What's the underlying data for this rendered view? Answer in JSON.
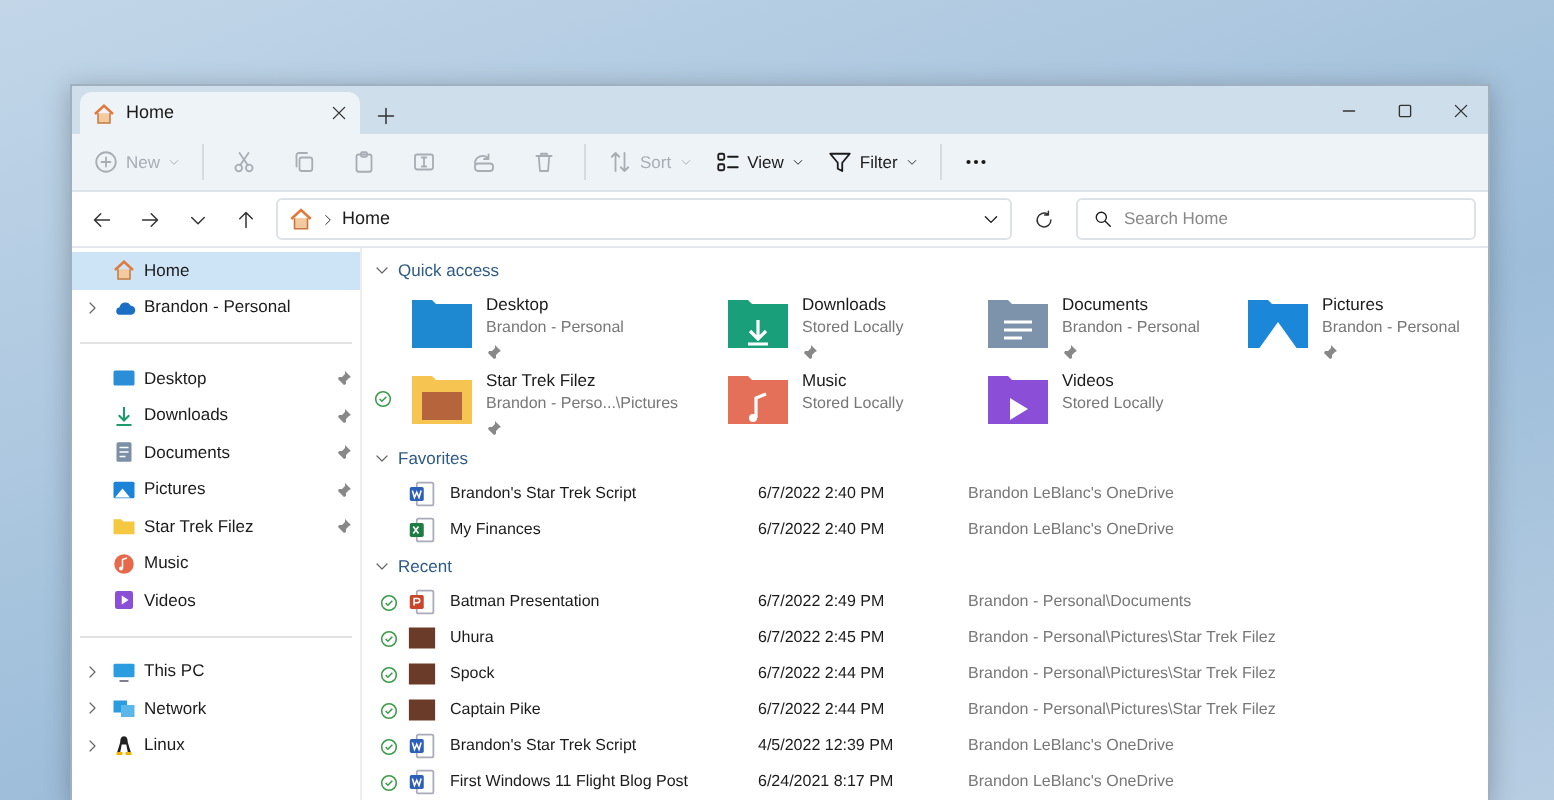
{
  "window": {
    "tab": {
      "title": "Home",
      "selected": true
    }
  },
  "toolbar": [
    {
      "kind": "new",
      "label": "New",
      "disabled": true,
      "dropdown": true
    },
    {
      "kind": "cut",
      "disabled": true
    },
    {
      "kind": "copy",
      "disabled": true
    },
    {
      "kind": "paste",
      "disabled": true
    },
    {
      "kind": "rename",
      "disabled": true
    },
    {
      "kind": "share",
      "disabled": true
    },
    {
      "kind": "delete",
      "disabled": true
    },
    {
      "kind": "sort",
      "label": "Sort",
      "disabled": true,
      "dropdown": true
    },
    {
      "kind": "view",
      "label": "View",
      "disabled": false,
      "dropdown": true
    },
    {
      "kind": "filter",
      "label": "Filter",
      "disabled": false,
      "dropdown": true
    },
    {
      "kind": "more",
      "disabled": false
    }
  ],
  "address": {
    "path": [
      "Home"
    ]
  },
  "search": {
    "placeholder": "Search Home"
  },
  "sidebar": {
    "groups": [
      [
        {
          "label": "Home",
          "kind": "home",
          "selected": true,
          "pinned": false
        },
        {
          "label": "Brandon - Personal",
          "kind": "cloud",
          "selected": false,
          "expanded": false,
          "pinned": false
        }
      ],
      [
        {
          "label": "Desktop",
          "kind": "desktop",
          "selected": false,
          "pinned": true
        },
        {
          "label": "Downloads",
          "kind": "downloads",
          "selected": false,
          "pinned": true
        },
        {
          "label": "Documents",
          "kind": "documents",
          "selected": false,
          "pinned": true
        },
        {
          "label": "Pictures",
          "kind": "pictures",
          "selected": false,
          "pinned": true
        },
        {
          "label": "Star Trek Filez",
          "kind": "folder",
          "selected": false,
          "pinned": true
        },
        {
          "label": "Music",
          "kind": "music",
          "selected": false,
          "pinned": false
        },
        {
          "label": "Videos",
          "kind": "videos",
          "selected": false,
          "pinned": false
        }
      ],
      [
        {
          "label": "This PC",
          "kind": "pc",
          "selected": false,
          "expanded": false,
          "pinned": false
        },
        {
          "label": "Network",
          "kind": "network",
          "selected": false,
          "expanded": false,
          "pinned": false
        },
        {
          "label": "Linux",
          "kind": "linux",
          "selected": false,
          "expanded": false,
          "pinned": false
        }
      ]
    ]
  },
  "quick_access": {
    "title": "Quick access",
    "expanded": true,
    "items": [
      {
        "name": "Desktop",
        "location": "Brandon - Personal",
        "kind": "desktop",
        "pinned": true,
        "synced": false
      },
      {
        "name": "Downloads",
        "location": "Stored Locally",
        "kind": "downloads",
        "pinned": true,
        "synced": false
      },
      {
        "name": "Documents",
        "location": "Brandon - Personal",
        "kind": "documents",
        "pinned": true,
        "synced": false
      },
      {
        "name": "Pictures",
        "location": "Brandon - Personal",
        "kind": "pictures",
        "pinned": true,
        "synced": false
      },
      {
        "name": "Star Trek Filez",
        "location": "Brandon - Perso...\\Pictures",
        "kind": "folder",
        "pinned": true,
        "synced": true
      },
      {
        "name": "Music",
        "location": "Stored Locally",
        "kind": "music",
        "pinned": false,
        "synced": false
      },
      {
        "name": "Videos",
        "location": "Stored Locally",
        "kind": "videos",
        "pinned": false,
        "synced": false
      }
    ]
  },
  "favorites": {
    "title": "Favorites",
    "expanded": true,
    "rows": [
      {
        "name": "Brandon's Star Trek Script",
        "kind": "word",
        "date": "6/7/2022 2:40 PM",
        "location": "Brandon LeBlanc's OneDrive",
        "synced": false
      },
      {
        "name": "My Finances",
        "kind": "excel",
        "date": "6/7/2022 2:40 PM",
        "location": "Brandon LeBlanc's OneDrive",
        "synced": false
      }
    ]
  },
  "recent": {
    "title": "Recent",
    "expanded": true,
    "rows": [
      {
        "name": "Batman Presentation",
        "kind": "powerpoint",
        "date": "6/7/2022 2:49 PM",
        "location": "Brandon - Personal\\Documents",
        "synced": true
      },
      {
        "name": "Uhura",
        "kind": "photo",
        "date": "6/7/2022 2:45 PM",
        "location": "Brandon - Personal\\Pictures\\Star Trek Filez",
        "synced": true
      },
      {
        "name": "Spock",
        "kind": "photo",
        "date": "6/7/2022 2:44 PM",
        "location": "Brandon - Personal\\Pictures\\Star Trek Filez",
        "synced": true
      },
      {
        "name": "Captain Pike",
        "kind": "photo",
        "date": "6/7/2022 2:44 PM",
        "location": "Brandon - Personal\\Pictures\\Star Trek Filez",
        "synced": true
      },
      {
        "name": "Brandon's Star Trek Script",
        "kind": "word",
        "date": "4/5/2022 12:39 PM",
        "location": "Brandon LeBlanc's OneDrive",
        "synced": true
      },
      {
        "name": "First Windows 11 Flight Blog Post",
        "kind": "word",
        "date": "6/24/2021 8:17 PM",
        "location": "Brandon LeBlanc's OneDrive",
        "synced": true
      }
    ]
  }
}
